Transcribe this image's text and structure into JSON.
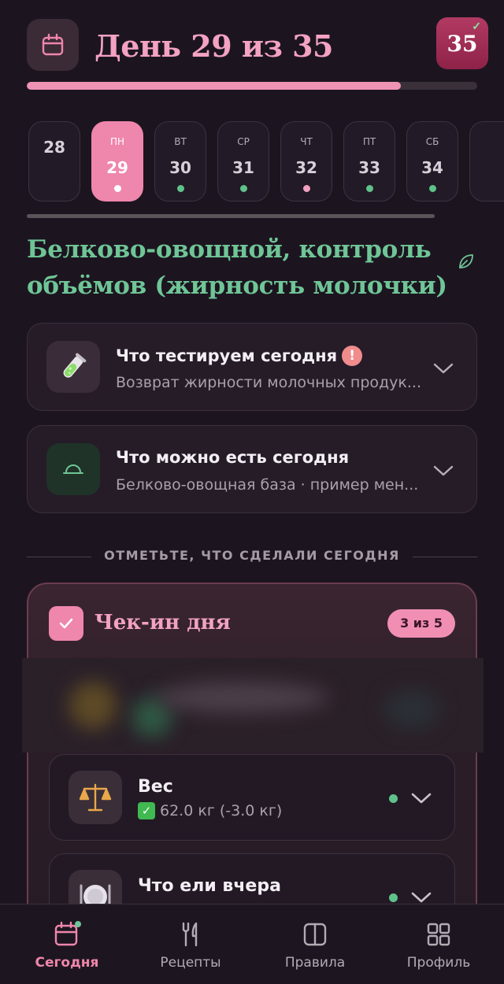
{
  "header": {
    "title": "День 29 из 35",
    "total_days": "35",
    "progress": 0.83
  },
  "day_strip": [
    {
      "dow": "",
      "num": "28",
      "dot": "",
      "active": false
    },
    {
      "dow": "ПН",
      "num": "29",
      "dot": "#ffffff",
      "active": true
    },
    {
      "dow": "ВТ",
      "num": "30",
      "dot": "#5fc28a",
      "active": false
    },
    {
      "dow": "СР",
      "num": "31",
      "dot": "#5fc28a",
      "active": false
    },
    {
      "dow": "ЧТ",
      "num": "32",
      "dot": "#f3a0c0",
      "active": false
    },
    {
      "dow": "ПТ",
      "num": "33",
      "dot": "#5fc28a",
      "active": false
    },
    {
      "dow": "СБ",
      "num": "34",
      "dot": "#5fc28a",
      "active": false
    }
  ],
  "phase_title": "Белково-овощной, контроль объёмов (жирность молочки)",
  "cards": {
    "test": {
      "title": "Что тестируем сегодня",
      "alert": "!",
      "subtitle": "Возврат жирности молочных продук..."
    },
    "food": {
      "title": "Что можно есть сегодня",
      "subtitle": "Белково-овощная база · пример мен..."
    }
  },
  "section_label": "ОТМЕТЬТЕ, ЧТО СДЕЛАЛИ СЕГОДНЯ",
  "checkin": {
    "title": "Чек-ин дня",
    "count": "3 из 5",
    "items": [
      {
        "title": "Вес",
        "value": "62.0 кг (-3.0 кг)",
        "icon": "scales-icon"
      },
      {
        "title": "Что ели вчера",
        "value": "",
        "icon": "plate-icon"
      }
    ]
  },
  "nav": [
    {
      "label": "Сегодня",
      "icon": "calendar-icon",
      "active": true
    },
    {
      "label": "Рецепты",
      "icon": "fork-knife-icon",
      "active": false
    },
    {
      "label": "Правила",
      "icon": "book-icon",
      "active": false
    },
    {
      "label": "Профиль",
      "icon": "grid-icon",
      "active": false
    }
  ],
  "colors": {
    "accent": "#ef86ab",
    "green": "#6fc596",
    "background": "#1c1520"
  }
}
